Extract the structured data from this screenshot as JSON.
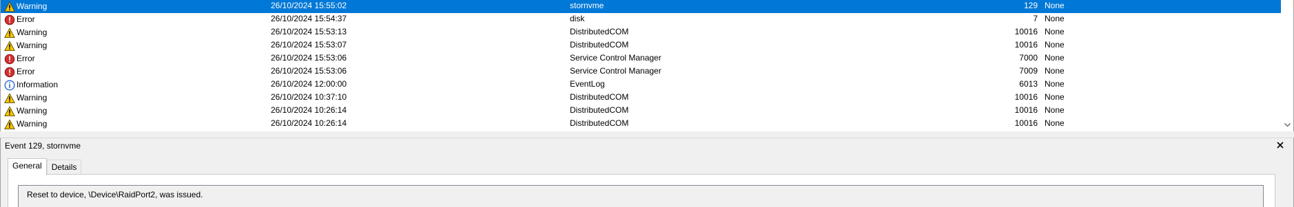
{
  "events": [
    {
      "level": "Warning",
      "icon": "warning-icon",
      "date": "26/10/2024 15:55:02",
      "source": "stornvme",
      "event_id": "129",
      "category": "None",
      "selected": true
    },
    {
      "level": "Error",
      "icon": "error-icon",
      "date": "26/10/2024 15:54:37",
      "source": "disk",
      "event_id": "7",
      "category": "None"
    },
    {
      "level": "Warning",
      "icon": "warning-icon",
      "date": "26/10/2024 15:53:13",
      "source": "DistributedCOM",
      "event_id": "10016",
      "category": "None"
    },
    {
      "level": "Warning",
      "icon": "warning-icon",
      "date": "26/10/2024 15:53:07",
      "source": "DistributedCOM",
      "event_id": "10016",
      "category": "None"
    },
    {
      "level": "Error",
      "icon": "error-icon",
      "date": "26/10/2024 15:53:06",
      "source": "Service Control Manager",
      "event_id": "7000",
      "category": "None"
    },
    {
      "level": "Error",
      "icon": "error-icon",
      "date": "26/10/2024 15:53:06",
      "source": "Service Control Manager",
      "event_id": "7009",
      "category": "None"
    },
    {
      "level": "Information",
      "icon": "information-icon",
      "date": "26/10/2024 12:00:00",
      "source": "EventLog",
      "event_id": "6013",
      "category": "None"
    },
    {
      "level": "Warning",
      "icon": "warning-icon",
      "date": "26/10/2024 10:37:10",
      "source": "DistributedCOM",
      "event_id": "10016",
      "category": "None"
    },
    {
      "level": "Warning",
      "icon": "warning-icon",
      "date": "26/10/2024 10:26:14",
      "source": "DistributedCOM",
      "event_id": "10016",
      "category": "None"
    },
    {
      "level": "Warning",
      "icon": "warning-icon",
      "date": "26/10/2024 10:26:14",
      "source": "DistributedCOM",
      "event_id": "10016",
      "category": "None"
    }
  ],
  "detail": {
    "title": "Event 129, stornvme",
    "tabs": [
      {
        "label": "General",
        "active": true
      },
      {
        "label": "Details",
        "active": false
      }
    ],
    "message": "Reset to device, \\Device\\RaidPort2, was issued."
  },
  "colors": {
    "selection": "#0078d7",
    "warning": "#f6c800",
    "error": "#d32f2f",
    "information": "#2a6bd1"
  }
}
